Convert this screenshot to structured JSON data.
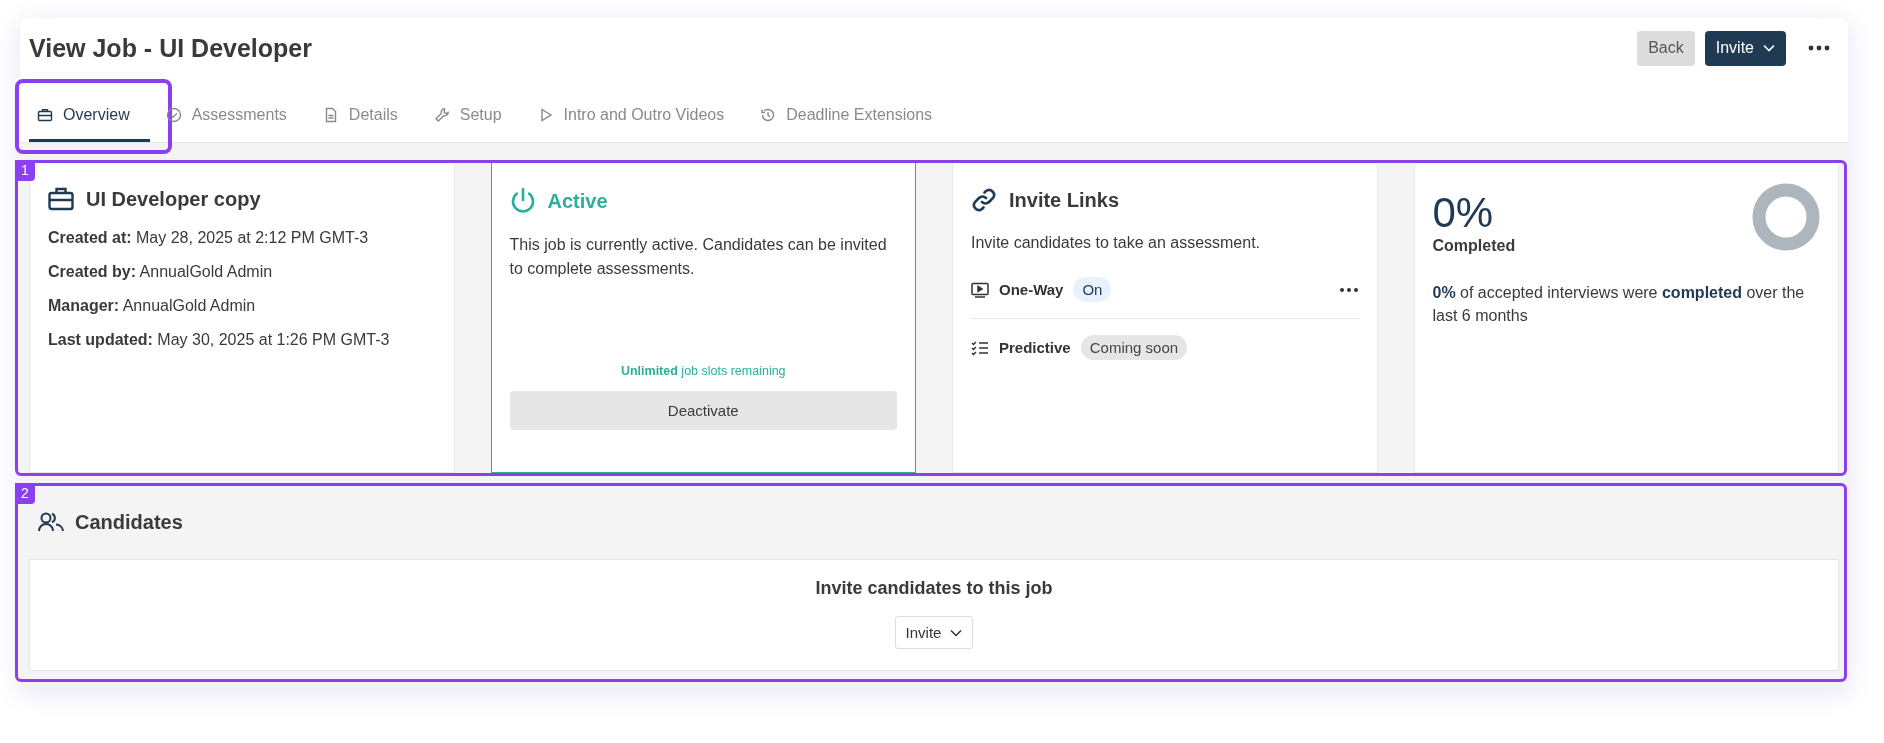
{
  "page": {
    "title": "View Job - UI Developer"
  },
  "header_buttons": [
    {
      "label": "Back",
      "kind": "secondary"
    },
    {
      "label": "Invite",
      "kind": "primary"
    }
  ],
  "tabs": [
    {
      "label": "Overview",
      "selected": true,
      "highlighted": true
    },
    {
      "label": "Assessments",
      "selected": false,
      "highlighted": false
    },
    {
      "label": "Details",
      "selected": false,
      "highlighted": false
    },
    {
      "label": "Setup",
      "selected": false,
      "highlighted": false
    },
    {
      "label": "Intro and Outro Videos",
      "selected": false,
      "highlighted": false
    },
    {
      "label": "Deadline Extensions",
      "selected": false,
      "highlighted": false
    }
  ],
  "overview_highlight": {
    "label": "1"
  },
  "job_card": {
    "title": "UI Developer copy",
    "fields": [
      {
        "label": "Created at:",
        "value": "May 28, 2025 at 2:12 PM GMT-3"
      },
      {
        "label": "Created by:",
        "value": "AnnualGold Admin"
      },
      {
        "label": "Manager:",
        "value": "AnnualGold Admin"
      },
      {
        "label": "Last updated:",
        "value": "May 30, 2025 at 1:26 PM GMT-3"
      }
    ]
  },
  "status_card": {
    "status": "Active",
    "kind": "active",
    "description": "This job is currently active. Candidates can be invited to complete assessments.",
    "slots": "**Unlimited** job slots remaining",
    "button": "Deactivate"
  },
  "invite_links_card": {
    "title": "Invite Links",
    "description": "Invite candidates to take an assessment.",
    "links": [
      {
        "name": "One-Way",
        "badge": "On",
        "kind": "on"
      },
      {
        "name": "Predictive",
        "badge": "Coming soon",
        "kind": "soon"
      }
    ]
  },
  "completion_card": {
    "value": "0%",
    "label": "Completed",
    "summary": "**0%** of accepted interviews were **completed** over the last 6 months"
  },
  "candidates": {
    "highlight_label": "2",
    "title": "Candidates",
    "empty_title": "Invite candidates to this job",
    "invite_button": "Invite"
  }
}
